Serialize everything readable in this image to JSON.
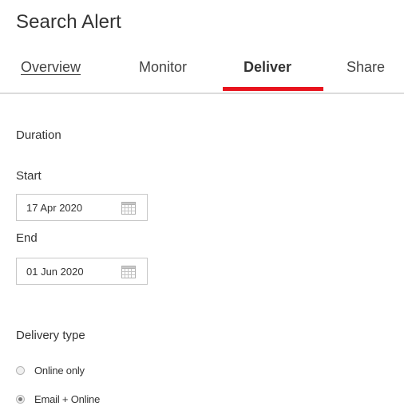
{
  "header": {
    "title": "Search Alert"
  },
  "tabs": [
    {
      "label": "Overview",
      "active": false
    },
    {
      "label": "Monitor",
      "active": false
    },
    {
      "label": "Deliver",
      "active": true
    },
    {
      "label": "Share",
      "active": false
    }
  ],
  "colors": {
    "accent": "#e8141e"
  },
  "duration": {
    "heading": "Duration",
    "start": {
      "label": "Start",
      "value": "17 Apr 2020",
      "icon": "calendar-icon"
    },
    "end": {
      "label": "End",
      "value": "01 Jun 2020",
      "icon": "calendar-icon"
    }
  },
  "delivery": {
    "heading": "Delivery type",
    "options": [
      {
        "label": "Online only",
        "selected": false
      },
      {
        "label": "Email + Online",
        "selected": true
      }
    ]
  }
}
